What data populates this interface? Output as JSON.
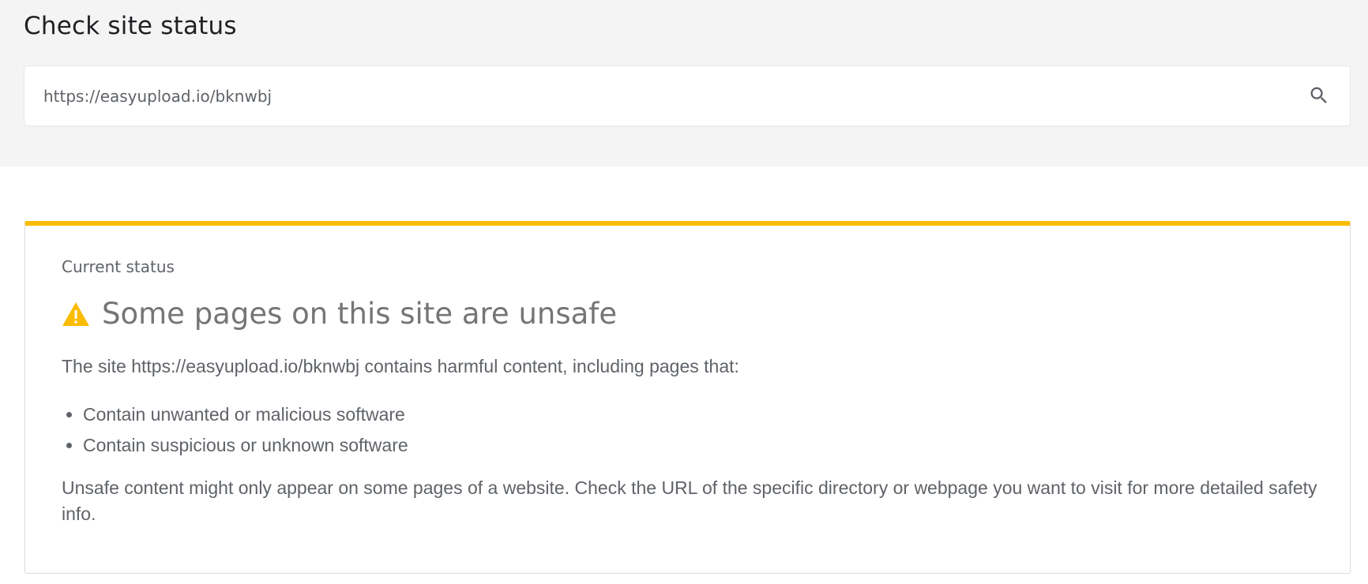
{
  "header": {
    "title": "Check site status"
  },
  "search": {
    "value": "https://easyupload.io/bknwbj",
    "icon": "search-icon"
  },
  "status": {
    "label": "Current status",
    "accent_color": "#fbbc04",
    "icon": "warning-icon",
    "heading": "Some pages on this site are unsafe",
    "description": "The site https://easyupload.io/bknwbj contains harmful content, including pages that:",
    "reasons": [
      "Contain unwanted or malicious software",
      "Contain suspicious or unknown software"
    ],
    "note": "Unsafe content might only appear on some pages of a website. Check the URL of the specific directory or webpage you want to visit for more detailed safety info."
  }
}
